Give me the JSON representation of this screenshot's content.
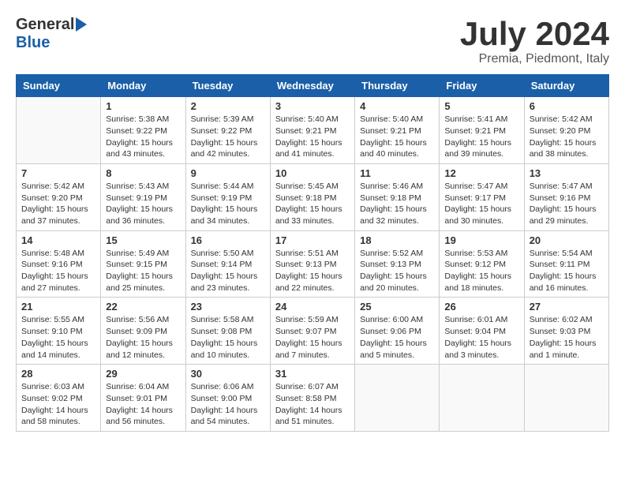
{
  "header": {
    "logo_general": "General",
    "logo_blue": "Blue",
    "month": "July 2024",
    "location": "Premia, Piedmont, Italy"
  },
  "days_of_week": [
    "Sunday",
    "Monday",
    "Tuesday",
    "Wednesday",
    "Thursday",
    "Friday",
    "Saturday"
  ],
  "weeks": [
    [
      {
        "day": "",
        "info": ""
      },
      {
        "day": "1",
        "info": "Sunrise: 5:38 AM\nSunset: 9:22 PM\nDaylight: 15 hours and 43 minutes."
      },
      {
        "day": "2",
        "info": "Sunrise: 5:39 AM\nSunset: 9:22 PM\nDaylight: 15 hours and 42 minutes."
      },
      {
        "day": "3",
        "info": "Sunrise: 5:40 AM\nSunset: 9:21 PM\nDaylight: 15 hours and 41 minutes."
      },
      {
        "day": "4",
        "info": "Sunrise: 5:40 AM\nSunset: 9:21 PM\nDaylight: 15 hours and 40 minutes."
      },
      {
        "day": "5",
        "info": "Sunrise: 5:41 AM\nSunset: 9:21 PM\nDaylight: 15 hours and 39 minutes."
      },
      {
        "day": "6",
        "info": "Sunrise: 5:42 AM\nSunset: 9:20 PM\nDaylight: 15 hours and 38 minutes."
      }
    ],
    [
      {
        "day": "7",
        "info": "Sunrise: 5:42 AM\nSunset: 9:20 PM\nDaylight: 15 hours and 37 minutes."
      },
      {
        "day": "8",
        "info": "Sunrise: 5:43 AM\nSunset: 9:19 PM\nDaylight: 15 hours and 36 minutes."
      },
      {
        "day": "9",
        "info": "Sunrise: 5:44 AM\nSunset: 9:19 PM\nDaylight: 15 hours and 34 minutes."
      },
      {
        "day": "10",
        "info": "Sunrise: 5:45 AM\nSunset: 9:18 PM\nDaylight: 15 hours and 33 minutes."
      },
      {
        "day": "11",
        "info": "Sunrise: 5:46 AM\nSunset: 9:18 PM\nDaylight: 15 hours and 32 minutes."
      },
      {
        "day": "12",
        "info": "Sunrise: 5:47 AM\nSunset: 9:17 PM\nDaylight: 15 hours and 30 minutes."
      },
      {
        "day": "13",
        "info": "Sunrise: 5:47 AM\nSunset: 9:16 PM\nDaylight: 15 hours and 29 minutes."
      }
    ],
    [
      {
        "day": "14",
        "info": "Sunrise: 5:48 AM\nSunset: 9:16 PM\nDaylight: 15 hours and 27 minutes."
      },
      {
        "day": "15",
        "info": "Sunrise: 5:49 AM\nSunset: 9:15 PM\nDaylight: 15 hours and 25 minutes."
      },
      {
        "day": "16",
        "info": "Sunrise: 5:50 AM\nSunset: 9:14 PM\nDaylight: 15 hours and 23 minutes."
      },
      {
        "day": "17",
        "info": "Sunrise: 5:51 AM\nSunset: 9:13 PM\nDaylight: 15 hours and 22 minutes."
      },
      {
        "day": "18",
        "info": "Sunrise: 5:52 AM\nSunset: 9:13 PM\nDaylight: 15 hours and 20 minutes."
      },
      {
        "day": "19",
        "info": "Sunrise: 5:53 AM\nSunset: 9:12 PM\nDaylight: 15 hours and 18 minutes."
      },
      {
        "day": "20",
        "info": "Sunrise: 5:54 AM\nSunset: 9:11 PM\nDaylight: 15 hours and 16 minutes."
      }
    ],
    [
      {
        "day": "21",
        "info": "Sunrise: 5:55 AM\nSunset: 9:10 PM\nDaylight: 15 hours and 14 minutes."
      },
      {
        "day": "22",
        "info": "Sunrise: 5:56 AM\nSunset: 9:09 PM\nDaylight: 15 hours and 12 minutes."
      },
      {
        "day": "23",
        "info": "Sunrise: 5:58 AM\nSunset: 9:08 PM\nDaylight: 15 hours and 10 minutes."
      },
      {
        "day": "24",
        "info": "Sunrise: 5:59 AM\nSunset: 9:07 PM\nDaylight: 15 hours and 7 minutes."
      },
      {
        "day": "25",
        "info": "Sunrise: 6:00 AM\nSunset: 9:06 PM\nDaylight: 15 hours and 5 minutes."
      },
      {
        "day": "26",
        "info": "Sunrise: 6:01 AM\nSunset: 9:04 PM\nDaylight: 15 hours and 3 minutes."
      },
      {
        "day": "27",
        "info": "Sunrise: 6:02 AM\nSunset: 9:03 PM\nDaylight: 15 hours and 1 minute."
      }
    ],
    [
      {
        "day": "28",
        "info": "Sunrise: 6:03 AM\nSunset: 9:02 PM\nDaylight: 14 hours and 58 minutes."
      },
      {
        "day": "29",
        "info": "Sunrise: 6:04 AM\nSunset: 9:01 PM\nDaylight: 14 hours and 56 minutes."
      },
      {
        "day": "30",
        "info": "Sunrise: 6:06 AM\nSunset: 9:00 PM\nDaylight: 14 hours and 54 minutes."
      },
      {
        "day": "31",
        "info": "Sunrise: 6:07 AM\nSunset: 8:58 PM\nDaylight: 14 hours and 51 minutes."
      },
      {
        "day": "",
        "info": ""
      },
      {
        "day": "",
        "info": ""
      },
      {
        "day": "",
        "info": ""
      }
    ]
  ]
}
